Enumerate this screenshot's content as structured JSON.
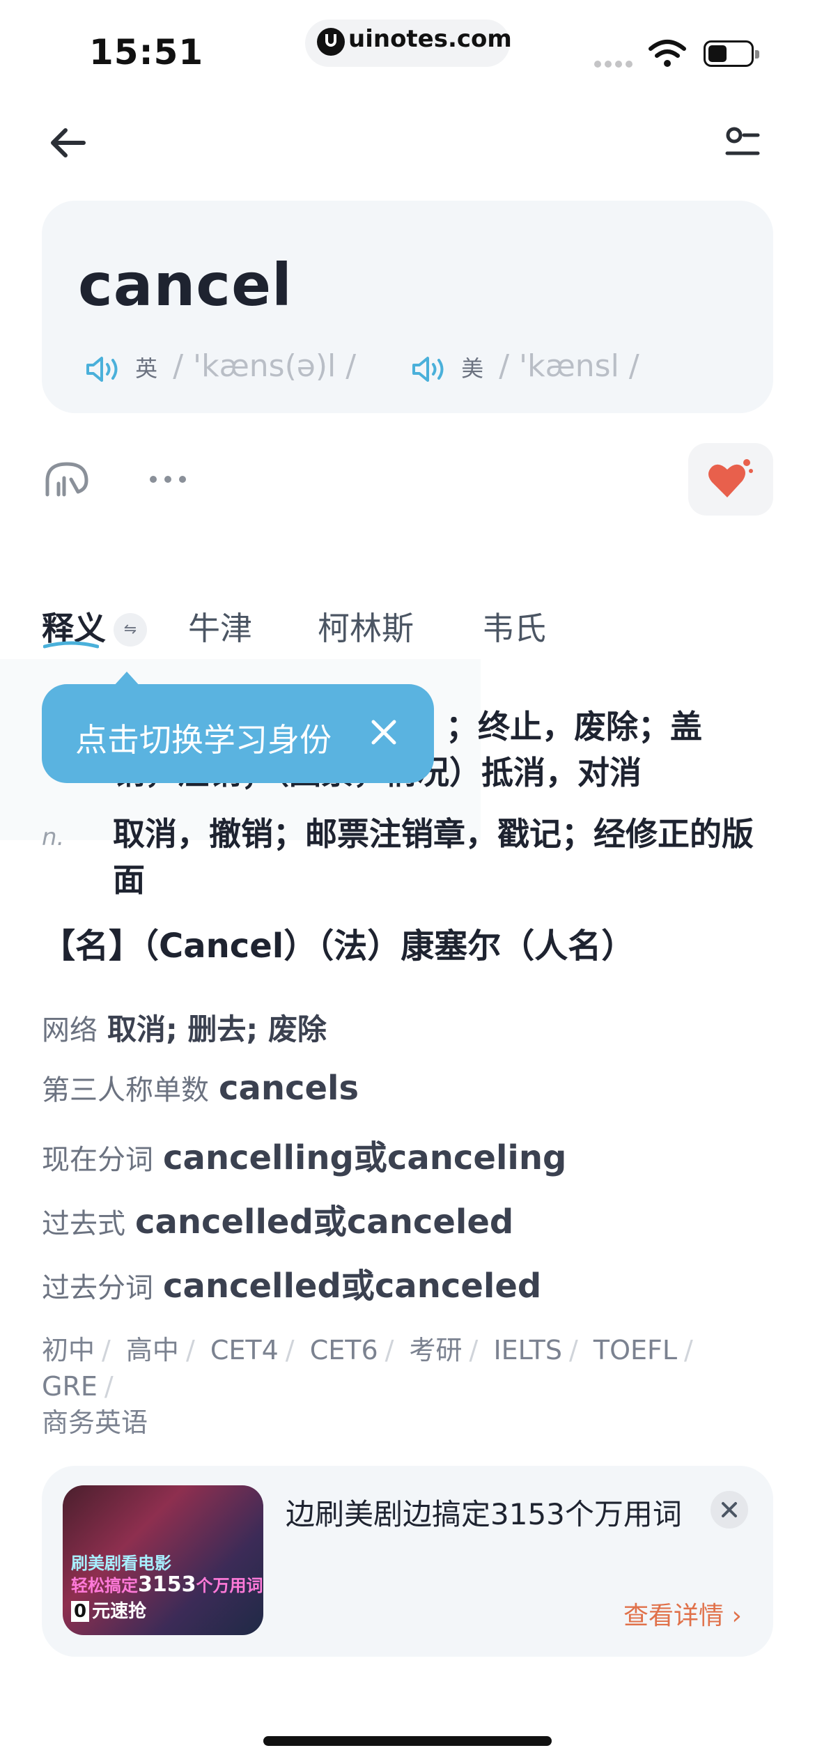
{
  "status_bar": {
    "time": "15:51",
    "url": "uinotes.com"
  },
  "word": {
    "headword": "cancel",
    "pron_uk_label": "英",
    "pron_uk": "/ 'kæns(ə)l /",
    "pron_us_label": "美",
    "pron_us": "/ 'kænsl /"
  },
  "tabs": [
    {
      "label": "释义"
    },
    {
      "label": "牛津"
    },
    {
      "label": "柯林斯"
    },
    {
      "label": "韦氏"
    }
  ],
  "tooltip": {
    "text": "点击切换学习身份"
  },
  "definitions": {
    "v_line1": "；终止，废除；盖",
    "v_line2": "销，注销；（因素，情况）抵消，对消",
    "n_pos": "n.",
    "n_text": "取消，撤销；邮票注销章，戳记；经修正的版面",
    "name_line": "【名】（Cancel）（法）康塞尔（人名）"
  },
  "forms": [
    {
      "key": "网络",
      "value": "取消; 删去; 废除"
    },
    {
      "key": "第三人称单数",
      "value": "cancels"
    },
    {
      "key": "现在分词",
      "value": "cancelling或canceling"
    },
    {
      "key": "过去式",
      "value": "cancelled或canceled"
    },
    {
      "key": "过去分词",
      "value": "cancelled或canceled"
    }
  ],
  "levels": [
    "初中",
    "高中",
    "CET4",
    "CET6",
    "考研",
    "IELTS",
    "TOEFL",
    "GRE",
    "商务英语"
  ],
  "ad": {
    "title": "边刷美剧边搞定3153个万用词",
    "more": "查看详情 ›",
    "img_line1": "刷美剧看电影",
    "img_line2a": "轻松搞定",
    "img_line2b": "3153",
    "img_line2c": "个万用词",
    "img_line3a": "0",
    "img_line3b": "元速抢"
  },
  "colors": {
    "accent": "#5ab3e0",
    "heart": "#e8604c",
    "link": "#e0714a"
  }
}
